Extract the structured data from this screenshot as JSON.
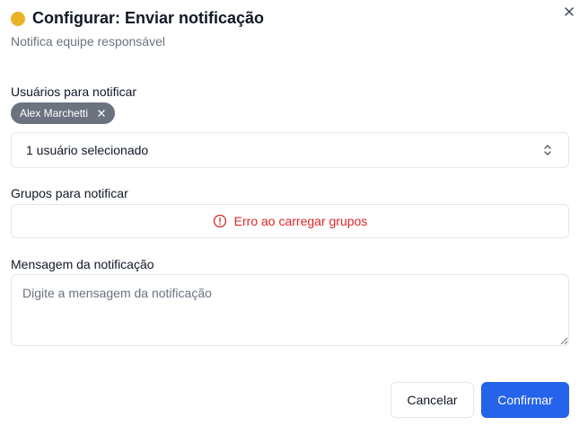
{
  "dialog": {
    "title": "Configurar: Enviar notificação",
    "subtitle": "Notifica equipe responsável",
    "status_color": "#eab327",
    "close_icon": "close-icon"
  },
  "users": {
    "label": "Usuários para notificar",
    "selected_chips": [
      {
        "name": "Alex Marchetti",
        "remove_icon": "close-icon"
      }
    ],
    "select_value": "1 usuário selecionado",
    "select_icon": "chevron-up-down-icon"
  },
  "groups": {
    "label": "Grupos para notificar",
    "error_text": "Erro ao carregar grupos",
    "error_icon": "alert-circle-icon",
    "error_color": "#dc2626"
  },
  "message": {
    "label": "Mensagem da notificação",
    "placeholder": "Digite a mensagem da notificação",
    "value": ""
  },
  "actions": {
    "cancel_label": "Cancelar",
    "confirm_label": "Confirmar",
    "confirm_color": "#2563eb"
  }
}
